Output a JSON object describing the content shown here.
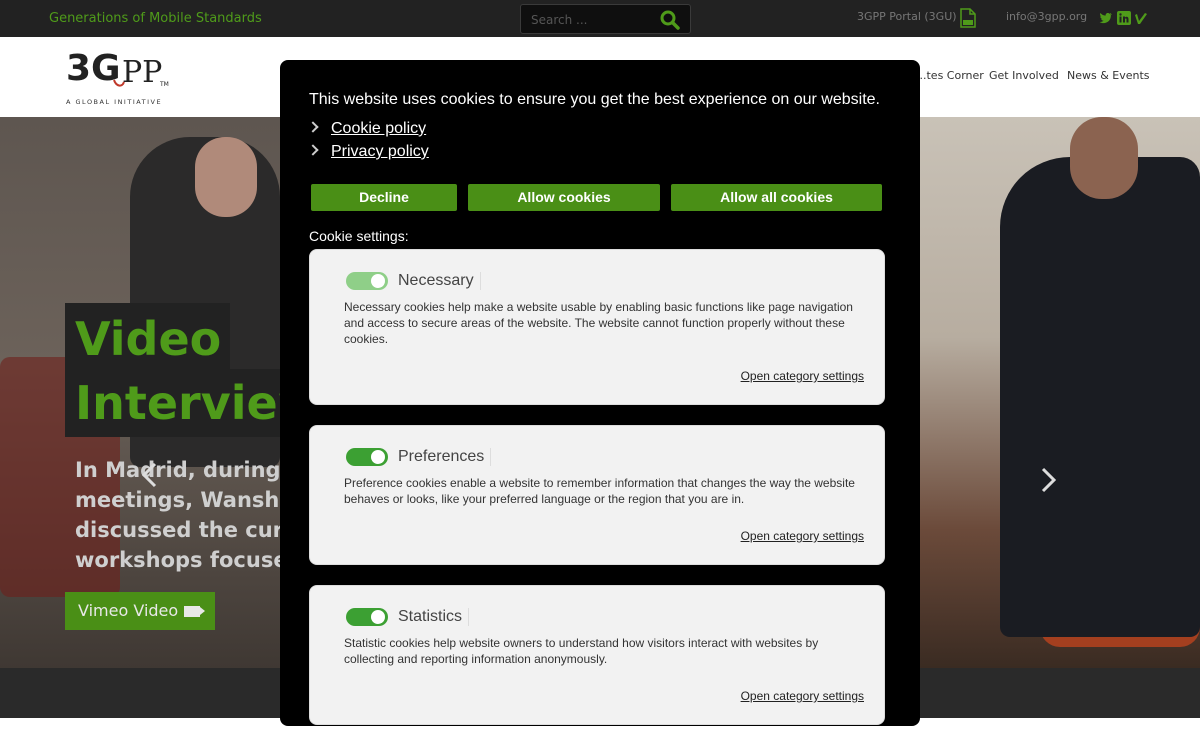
{
  "topbar": {
    "tagline": "Generations of Mobile Standards",
    "search_placeholder": "Search ...",
    "portal": "3GPP Portal (3GU)",
    "email": "info@3gpp.org"
  },
  "header": {
    "logo_tagline": "A GLOBAL INITIATIVE",
    "nav": [
      "...tes Corner",
      "Get Involved",
      "News & Events"
    ]
  },
  "hero": {
    "title_line1": "Video",
    "title_line2": "Interview",
    "desc_lines": [
      "In Madrid, during t",
      "meetings, Wanshi",
      "discussed the curr",
      "workshops focused"
    ],
    "button": "Vimeo Video"
  },
  "cookie_modal": {
    "intro": "This website uses cookies to ensure you get the best experience on our website.",
    "links": [
      "Cookie policy",
      "Privacy policy"
    ],
    "buttons": {
      "decline": "Decline",
      "allow": "Allow cookies",
      "allow_all": "Allow all cookies"
    },
    "settings_label": "Cookie settings:",
    "categories": [
      {
        "name": "Necessary",
        "enabled": true,
        "locked": true,
        "description": "Necessary cookies help make a website usable by enabling basic functions like page navigation and access to secure areas of the website. The website cannot function properly without these cookies.",
        "link": "Open category settings"
      },
      {
        "name": "Preferences",
        "enabled": true,
        "locked": false,
        "description": "Preference cookies enable a website to remember information that changes the way the website behaves or looks, like your preferred language or the region that you are in.",
        "link": "Open category settings"
      },
      {
        "name": "Statistics",
        "enabled": true,
        "locked": false,
        "description": "Statistic cookies help website owners to understand how visitors interact with websites by collecting and reporting information anonymously.",
        "link": "Open category settings"
      }
    ]
  },
  "colors": {
    "accent": "#4a8f16",
    "toggle_on": "#3ca033"
  }
}
